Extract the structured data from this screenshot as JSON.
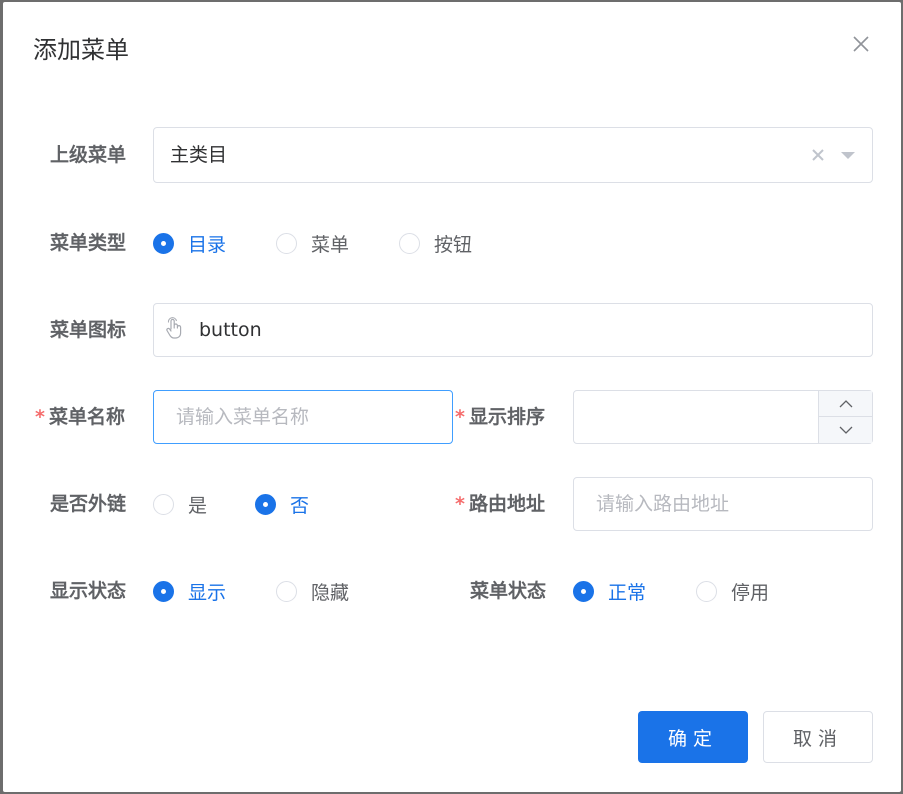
{
  "dialog": {
    "title": "添加菜单"
  },
  "form": {
    "parent_menu": {
      "label": "上级菜单",
      "value": "主类目"
    },
    "menu_type": {
      "label": "菜单类型",
      "options": [
        "目录",
        "菜单",
        "按钮"
      ],
      "selected": "目录"
    },
    "menu_icon": {
      "label": "菜单图标",
      "value": "button",
      "icon": "hand-pointer-icon"
    },
    "menu_name": {
      "label": "菜单名称",
      "required_mark": "*",
      "placeholder": "请输入菜单名称",
      "value": ""
    },
    "display_order": {
      "label": "显示排序",
      "required_mark": "*",
      "value": ""
    },
    "is_external": {
      "label": "是否外链",
      "options": [
        "是",
        "否"
      ],
      "selected": "否"
    },
    "route_path": {
      "label": "路由地址",
      "required_mark": "*",
      "placeholder": "请输入路由地址",
      "value": ""
    },
    "visible": {
      "label": "显示状态",
      "options": [
        "显示",
        "隐藏"
      ],
      "selected": "显示"
    },
    "status": {
      "label": "菜单状态",
      "options": [
        "正常",
        "停用"
      ],
      "selected": "正常"
    }
  },
  "footer": {
    "confirm_label": "确定",
    "cancel_label": "取消"
  },
  "colors": {
    "primary": "#1a73e8",
    "required": "#f56c6c",
    "border": "#dcdfe6",
    "focus_border": "#409eff"
  }
}
